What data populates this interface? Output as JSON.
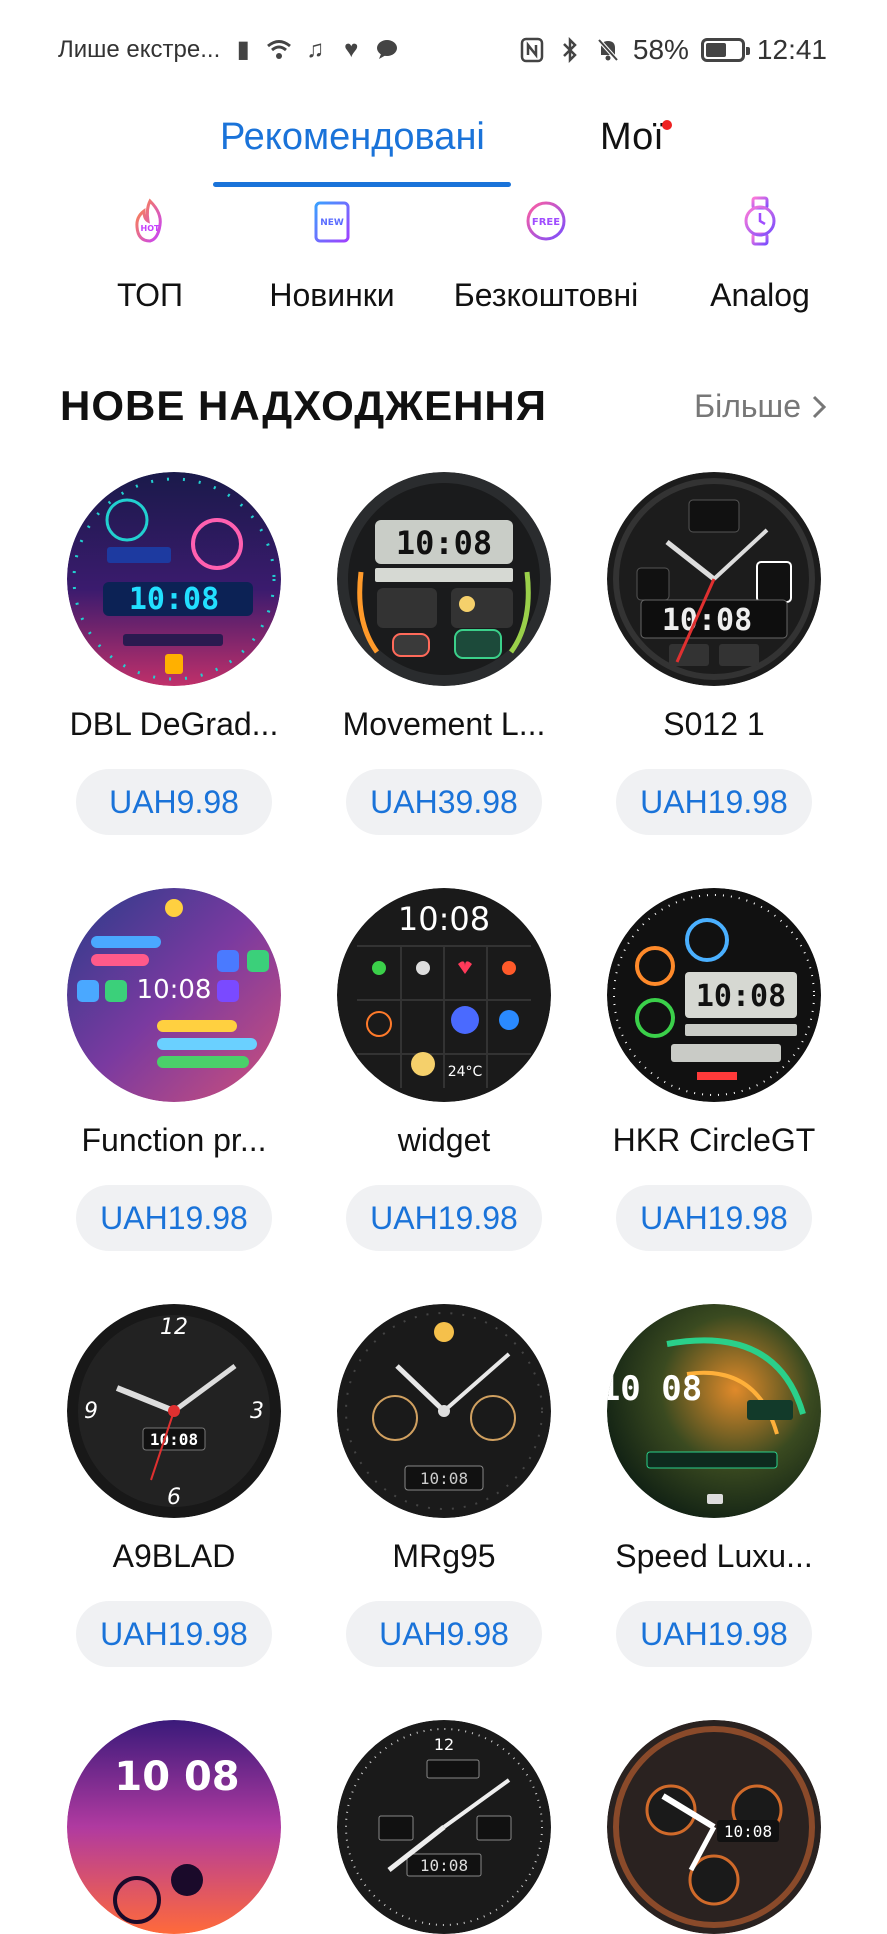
{
  "status": {
    "carrier": "Лише екстре...",
    "battery": "58%",
    "battery_level": 0.58,
    "time": "12:41",
    "left_icons": [
      "sim-icon",
      "wifi-icon",
      "music-icon",
      "health-icon",
      "chat-icon"
    ],
    "right_icons": [
      "nfc-icon",
      "bluetooth-icon",
      "mute-icon"
    ]
  },
  "tabs": [
    {
      "label": "Рекомендовані",
      "active": true
    },
    {
      "label": "Мої",
      "active": false,
      "dot": true
    }
  ],
  "categories": [
    {
      "label": "ТОП",
      "icon": "hot-icon"
    },
    {
      "label": "Новинки",
      "icon": "new-icon"
    },
    {
      "label": "Безкоштовні",
      "icon": "free-icon"
    },
    {
      "label": "Analog",
      "icon": "watch-icon"
    }
  ],
  "section": {
    "title": "НОВЕ НАДХОДЖЕННЯ",
    "more": "Більше"
  },
  "items": [
    {
      "name": "DBL DeGrad...",
      "price": "UAH9.98",
      "style": "neon",
      "display": "10:08"
    },
    {
      "name": "Movement L...",
      "price": "UAH39.98",
      "style": "lcd",
      "display": "10:08"
    },
    {
      "name": "S012 1",
      "price": "UAH19.98",
      "style": "sport",
      "display": "10:08"
    },
    {
      "name": "Function pr...",
      "price": "UAH19.98",
      "style": "gradient",
      "display": "10:08"
    },
    {
      "name": "widget",
      "price": "UAH19.98",
      "style": "widget",
      "display": "10:08"
    },
    {
      "name": "HKR CircleGT",
      "price": "UAH19.98",
      "style": "circle",
      "display": "10:08"
    },
    {
      "name": "A9BLAD",
      "price": "UAH19.98",
      "style": "analog",
      "display": "10:08"
    },
    {
      "name": "MRg95",
      "price": "UAH9.98",
      "style": "analog2",
      "display": "10:08"
    },
    {
      "name": "Speed Luxu...",
      "price": "UAH19.98",
      "style": "speed",
      "display": "10 08"
    },
    {
      "name": "",
      "price": "",
      "style": "purple",
      "display": "10 08"
    },
    {
      "name": "",
      "price": "",
      "style": "analog3",
      "display": "10:08"
    },
    {
      "name": "",
      "price": "",
      "style": "chrono",
      "display": "10:08"
    }
  ],
  "colors": {
    "accent": "#1a73d9",
    "price_bg": "#f0f1f3"
  }
}
